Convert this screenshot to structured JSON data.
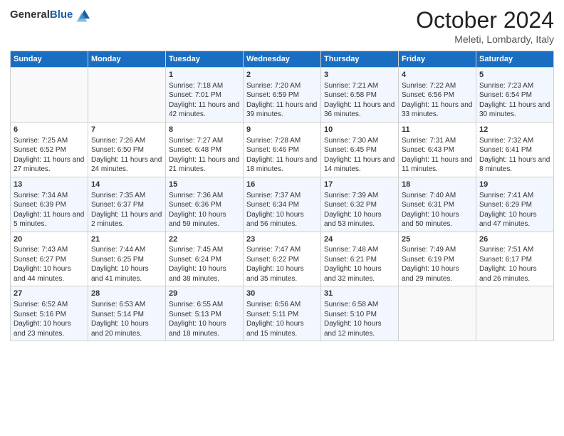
{
  "logo": {
    "general": "General",
    "blue": "Blue"
  },
  "header": {
    "title": "October 2024",
    "subtitle": "Meleti, Lombardy, Italy"
  },
  "weekdays": [
    "Sunday",
    "Monday",
    "Tuesday",
    "Wednesday",
    "Thursday",
    "Friday",
    "Saturday"
  ],
  "weeks": [
    [
      {
        "day": "",
        "sunrise": "",
        "sunset": "",
        "daylight": ""
      },
      {
        "day": "",
        "sunrise": "",
        "sunset": "",
        "daylight": ""
      },
      {
        "day": "1",
        "sunrise": "Sunrise: 7:18 AM",
        "sunset": "Sunset: 7:01 PM",
        "daylight": "Daylight: 11 hours and 42 minutes."
      },
      {
        "day": "2",
        "sunrise": "Sunrise: 7:20 AM",
        "sunset": "Sunset: 6:59 PM",
        "daylight": "Daylight: 11 hours and 39 minutes."
      },
      {
        "day": "3",
        "sunrise": "Sunrise: 7:21 AM",
        "sunset": "Sunset: 6:58 PM",
        "daylight": "Daylight: 11 hours and 36 minutes."
      },
      {
        "day": "4",
        "sunrise": "Sunrise: 7:22 AM",
        "sunset": "Sunset: 6:56 PM",
        "daylight": "Daylight: 11 hours and 33 minutes."
      },
      {
        "day": "5",
        "sunrise": "Sunrise: 7:23 AM",
        "sunset": "Sunset: 6:54 PM",
        "daylight": "Daylight: 11 hours and 30 minutes."
      }
    ],
    [
      {
        "day": "6",
        "sunrise": "Sunrise: 7:25 AM",
        "sunset": "Sunset: 6:52 PM",
        "daylight": "Daylight: 11 hours and 27 minutes."
      },
      {
        "day": "7",
        "sunrise": "Sunrise: 7:26 AM",
        "sunset": "Sunset: 6:50 PM",
        "daylight": "Daylight: 11 hours and 24 minutes."
      },
      {
        "day": "8",
        "sunrise": "Sunrise: 7:27 AM",
        "sunset": "Sunset: 6:48 PM",
        "daylight": "Daylight: 11 hours and 21 minutes."
      },
      {
        "day": "9",
        "sunrise": "Sunrise: 7:28 AM",
        "sunset": "Sunset: 6:46 PM",
        "daylight": "Daylight: 11 hours and 18 minutes."
      },
      {
        "day": "10",
        "sunrise": "Sunrise: 7:30 AM",
        "sunset": "Sunset: 6:45 PM",
        "daylight": "Daylight: 11 hours and 14 minutes."
      },
      {
        "day": "11",
        "sunrise": "Sunrise: 7:31 AM",
        "sunset": "Sunset: 6:43 PM",
        "daylight": "Daylight: 11 hours and 11 minutes."
      },
      {
        "day": "12",
        "sunrise": "Sunrise: 7:32 AM",
        "sunset": "Sunset: 6:41 PM",
        "daylight": "Daylight: 11 hours and 8 minutes."
      }
    ],
    [
      {
        "day": "13",
        "sunrise": "Sunrise: 7:34 AM",
        "sunset": "Sunset: 6:39 PM",
        "daylight": "Daylight: 11 hours and 5 minutes."
      },
      {
        "day": "14",
        "sunrise": "Sunrise: 7:35 AM",
        "sunset": "Sunset: 6:37 PM",
        "daylight": "Daylight: 11 hours and 2 minutes."
      },
      {
        "day": "15",
        "sunrise": "Sunrise: 7:36 AM",
        "sunset": "Sunset: 6:36 PM",
        "daylight": "Daylight: 10 hours and 59 minutes."
      },
      {
        "day": "16",
        "sunrise": "Sunrise: 7:37 AM",
        "sunset": "Sunset: 6:34 PM",
        "daylight": "Daylight: 10 hours and 56 minutes."
      },
      {
        "day": "17",
        "sunrise": "Sunrise: 7:39 AM",
        "sunset": "Sunset: 6:32 PM",
        "daylight": "Daylight: 10 hours and 53 minutes."
      },
      {
        "day": "18",
        "sunrise": "Sunrise: 7:40 AM",
        "sunset": "Sunset: 6:31 PM",
        "daylight": "Daylight: 10 hours and 50 minutes."
      },
      {
        "day": "19",
        "sunrise": "Sunrise: 7:41 AM",
        "sunset": "Sunset: 6:29 PM",
        "daylight": "Daylight: 10 hours and 47 minutes."
      }
    ],
    [
      {
        "day": "20",
        "sunrise": "Sunrise: 7:43 AM",
        "sunset": "Sunset: 6:27 PM",
        "daylight": "Daylight: 10 hours and 44 minutes."
      },
      {
        "day": "21",
        "sunrise": "Sunrise: 7:44 AM",
        "sunset": "Sunset: 6:25 PM",
        "daylight": "Daylight: 10 hours and 41 minutes."
      },
      {
        "day": "22",
        "sunrise": "Sunrise: 7:45 AM",
        "sunset": "Sunset: 6:24 PM",
        "daylight": "Daylight: 10 hours and 38 minutes."
      },
      {
        "day": "23",
        "sunrise": "Sunrise: 7:47 AM",
        "sunset": "Sunset: 6:22 PM",
        "daylight": "Daylight: 10 hours and 35 minutes."
      },
      {
        "day": "24",
        "sunrise": "Sunrise: 7:48 AM",
        "sunset": "Sunset: 6:21 PM",
        "daylight": "Daylight: 10 hours and 32 minutes."
      },
      {
        "day": "25",
        "sunrise": "Sunrise: 7:49 AM",
        "sunset": "Sunset: 6:19 PM",
        "daylight": "Daylight: 10 hours and 29 minutes."
      },
      {
        "day": "26",
        "sunrise": "Sunrise: 7:51 AM",
        "sunset": "Sunset: 6:17 PM",
        "daylight": "Daylight: 10 hours and 26 minutes."
      }
    ],
    [
      {
        "day": "27",
        "sunrise": "Sunrise: 6:52 AM",
        "sunset": "Sunset: 5:16 PM",
        "daylight": "Daylight: 10 hours and 23 minutes."
      },
      {
        "day": "28",
        "sunrise": "Sunrise: 6:53 AM",
        "sunset": "Sunset: 5:14 PM",
        "daylight": "Daylight: 10 hours and 20 minutes."
      },
      {
        "day": "29",
        "sunrise": "Sunrise: 6:55 AM",
        "sunset": "Sunset: 5:13 PM",
        "daylight": "Daylight: 10 hours and 18 minutes."
      },
      {
        "day": "30",
        "sunrise": "Sunrise: 6:56 AM",
        "sunset": "Sunset: 5:11 PM",
        "daylight": "Daylight: 10 hours and 15 minutes."
      },
      {
        "day": "31",
        "sunrise": "Sunrise: 6:58 AM",
        "sunset": "Sunset: 5:10 PM",
        "daylight": "Daylight: 10 hours and 12 minutes."
      },
      {
        "day": "",
        "sunrise": "",
        "sunset": "",
        "daylight": ""
      },
      {
        "day": "",
        "sunrise": "",
        "sunset": "",
        "daylight": ""
      }
    ]
  ]
}
